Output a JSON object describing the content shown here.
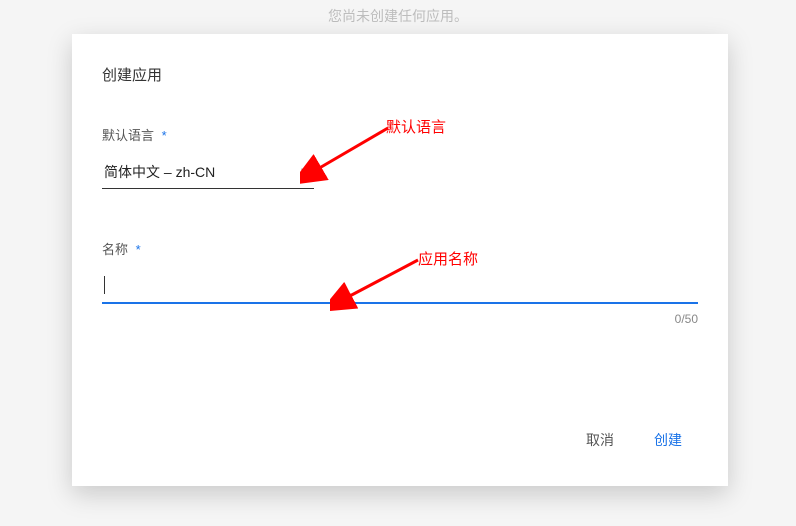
{
  "backdrop": {
    "text": "您尚未创建任何应用。"
  },
  "modal": {
    "title": "创建应用",
    "language": {
      "label": "默认语言",
      "required": "*",
      "selected": "简体中文 – zh-CN"
    },
    "name": {
      "label": "名称",
      "required": "*",
      "value": "",
      "counter": "0/50"
    },
    "actions": {
      "cancel": "取消",
      "create": "创建"
    }
  },
  "annotations": {
    "lang": "默认语言",
    "appname": "应用名称"
  }
}
